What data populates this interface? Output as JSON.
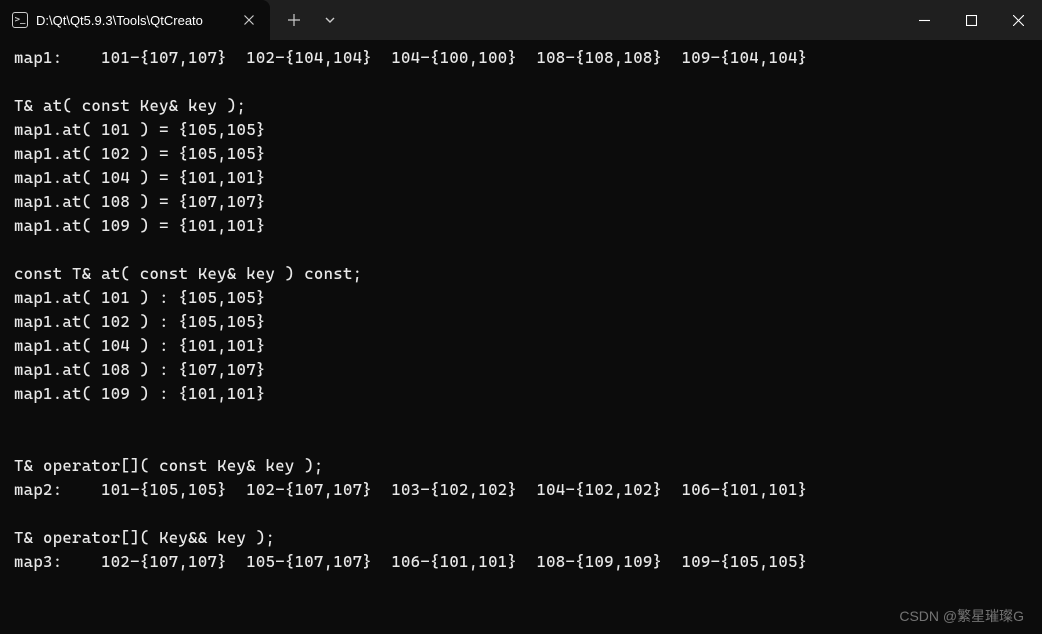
{
  "titlebar": {
    "tab": {
      "title": "D:\\Qt\\Qt5.9.3\\Tools\\QtCreato",
      "icon_label": "cmd-icon"
    },
    "add_tab_label": "+",
    "dropdown_label": "chevron-down"
  },
  "terminal": {
    "lines": [
      "map1:    101-{107,107}  102-{104,104}  104-{100,100}  108-{108,108}  109-{104,104}",
      "",
      "T& at( const Key& key );",
      "map1.at( 101 ) = {105,105}",
      "map1.at( 102 ) = {105,105}",
      "map1.at( 104 ) = {101,101}",
      "map1.at( 108 ) = {107,107}",
      "map1.at( 109 ) = {101,101}",
      "",
      "const T& at( const Key& key ) const;",
      "map1.at( 101 ) : {105,105}",
      "map1.at( 102 ) : {105,105}",
      "map1.at( 104 ) : {101,101}",
      "map1.at( 108 ) : {107,107}",
      "map1.at( 109 ) : {101,101}",
      "",
      "",
      "T& operator[]( const Key& key );",
      "map2:    101-{105,105}  102-{107,107}  103-{102,102}  104-{102,102}  106-{101,101}",
      "",
      "T& operator[]( Key&& key );",
      "map3:    102-{107,107}  105-{107,107}  106-{101,101}  108-{109,109}  109-{105,105}"
    ]
  },
  "watermark": "CSDN @繁星璀璨G"
}
